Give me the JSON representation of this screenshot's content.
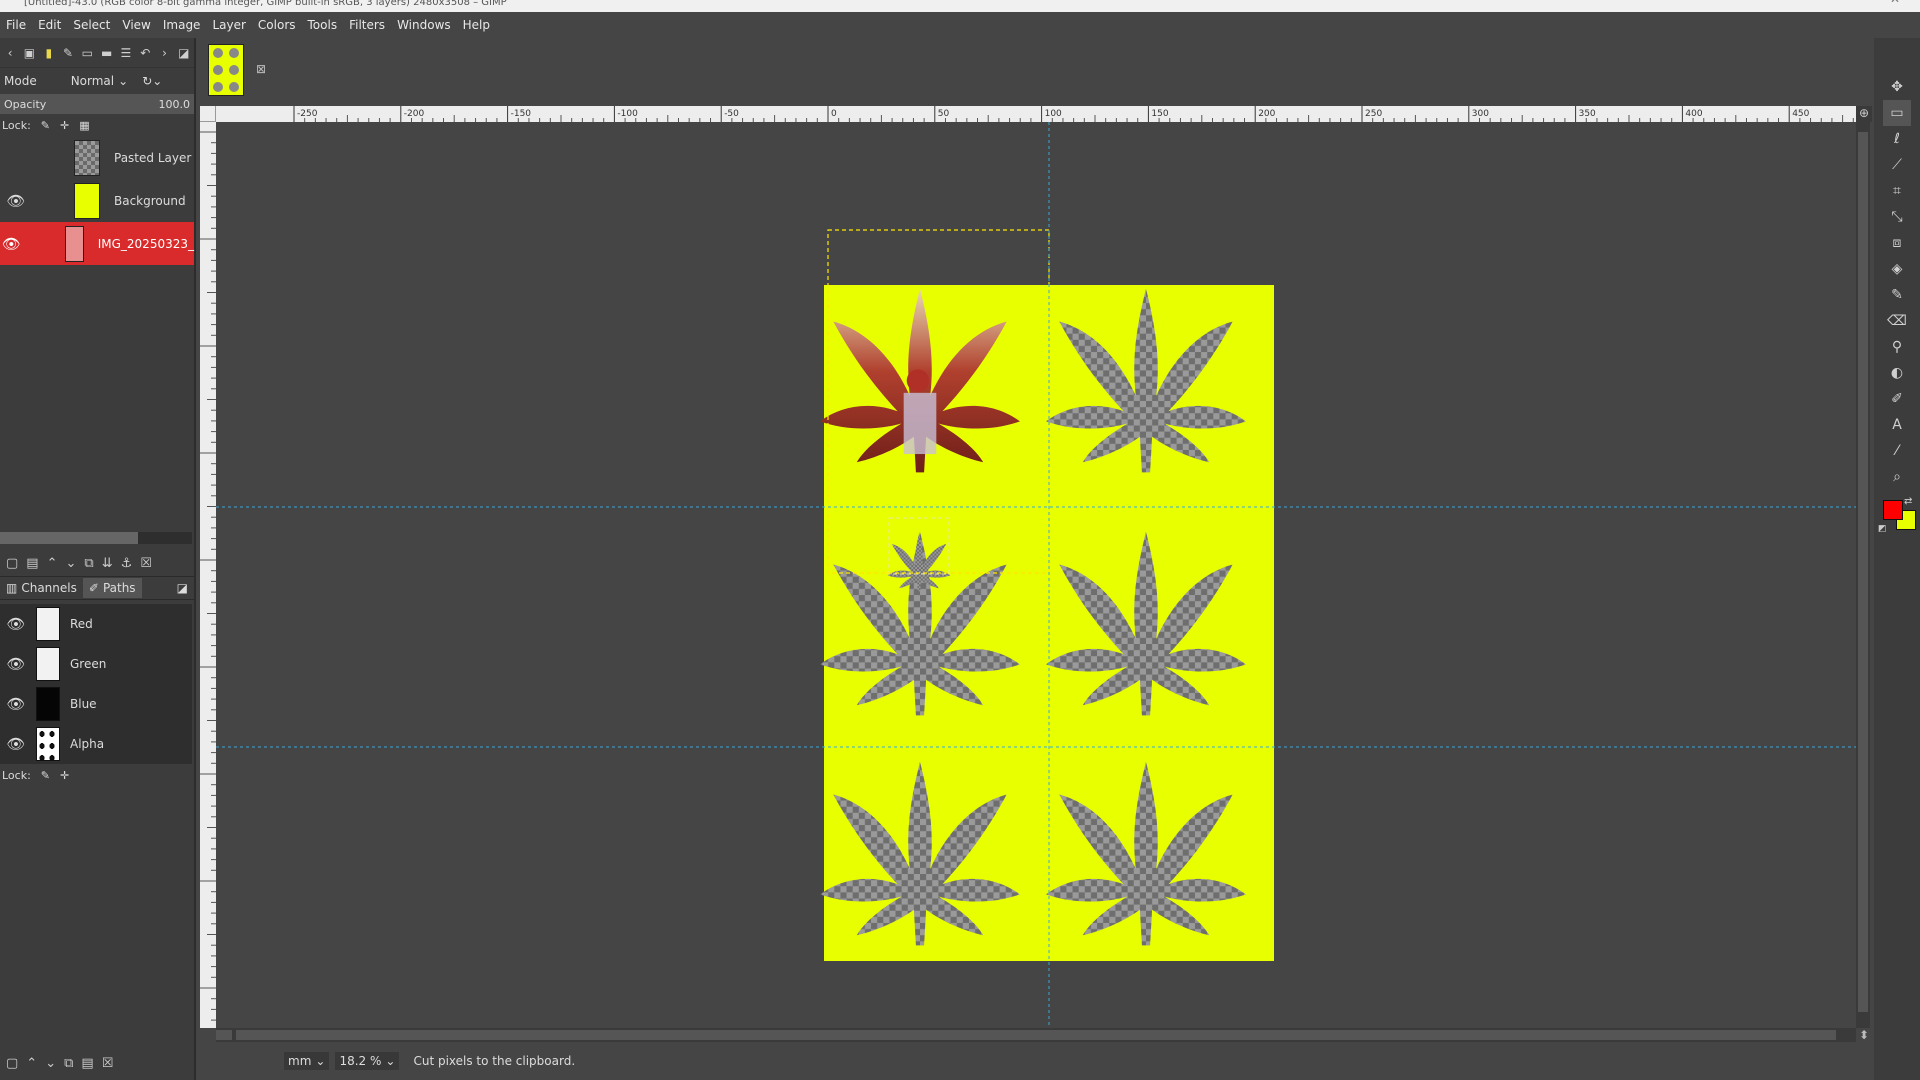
{
  "window": {
    "title": "[Untitled]-43.0 (RGB color 8-bit gamma integer, GIMP built-in sRGB, 3 layers) 2480x3508 – GIMP"
  },
  "menu": [
    "File",
    "Edit",
    "Select",
    "View",
    "Image",
    "Layer",
    "Colors",
    "Tools",
    "Filters",
    "Windows",
    "Help"
  ],
  "layers_panel": {
    "mode_label": "Mode",
    "mode_value": "Normal",
    "opacity_label": "Opacity",
    "opacity_value": "100.0",
    "lock_label": "Lock:",
    "layers": [
      {
        "name": "Pasted Layer",
        "visible": false,
        "active": false
      },
      {
        "name": "Background",
        "visible": true,
        "active": false
      },
      {
        "name": "IMG_20250323_",
        "visible": true,
        "active": true
      }
    ]
  },
  "channels_panel": {
    "tabs": [
      "Channels",
      "Paths"
    ],
    "channels": [
      "Red",
      "Green",
      "Blue",
      "Alpha"
    ],
    "lock_label": "Lock:"
  },
  "rulers": {
    "h_ticks": [
      "-250",
      "-200",
      "-150",
      "-100",
      "-50",
      "0",
      "50",
      "100",
      "150",
      "200",
      "250",
      "300",
      "350",
      "400",
      "450"
    ]
  },
  "status": {
    "unit": "mm",
    "zoom": "18.2 %",
    "message": "Cut pixels to the clipboard."
  },
  "colors": {
    "foreground": "#ff0000",
    "background": "#e8ff00",
    "canvas": "#e8ff00",
    "active_layer": "#d92b2b"
  }
}
